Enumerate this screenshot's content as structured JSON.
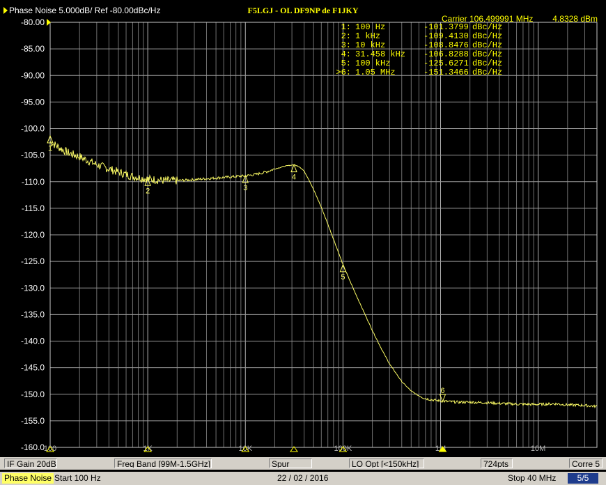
{
  "header": {
    "scale_label": "Phase Noise 5.000dB/ Ref -80.00dBc/Hz",
    "title": "F5LGJ - OL DF9NP de F1JKY",
    "carrier_label": "Carrier 106.499991 MHz",
    "carrier_power": "4.8328 dBm"
  },
  "markers": [
    {
      "index": "1:",
      "freq": "100 Hz",
      "value": "-101.3799",
      "unit": "dBc/Hz"
    },
    {
      "index": "2:",
      "freq": "1 kHz",
      "value": "-109.4130",
      "unit": "dBc/Hz"
    },
    {
      "index": "3:",
      "freq": "10 kHz",
      "value": "-108.8476",
      "unit": "dBc/Hz"
    },
    {
      "index": "4:",
      "freq": "31.458 kHz",
      "value": "-106.8288",
      "unit": "dBc/Hz"
    },
    {
      "index": "5:",
      "freq": "100 kHz",
      "value": "-125.6271",
      "unit": "dBc/Hz"
    },
    {
      "index": ">6:",
      "freq": "1.05 MHz",
      "value": "-151.3466",
      "unit": "dBc/Hz"
    }
  ],
  "status_bar": {
    "if_gain": "IF Gain 20dB",
    "freq_band": "Freq Band [99M-1.5GHz]",
    "spur": "Spur",
    "lo_opt": "LO Opt [<150kHz]",
    "points": "724pts",
    "corr": "Corre 5"
  },
  "footer": {
    "mode": "Phase Noise",
    "start": "Start 100 Hz",
    "date": "22 / 02 / 2016",
    "stop": "Stop 40 MHz",
    "page": "5/5"
  },
  "chart_data": {
    "type": "line",
    "x_scale": "log",
    "xlim": [
      100,
      40000000
    ],
    "ylim": [
      -160,
      -80
    ],
    "yticks": [
      -80,
      -85,
      -90,
      -95,
      -100,
      -105,
      -110,
      -115,
      -120,
      -125,
      -130,
      -135,
      -140,
      -145,
      -150,
      -155,
      -160
    ],
    "ytick_labels": [
      "-80.00",
      "-85.00",
      "-90.00",
      "-95.00",
      "-100.0",
      "-105.0",
      "-110.0",
      "-115.0",
      "-120.0",
      "-125.0",
      "-130.0",
      "-135.0",
      "-140.0",
      "-145.0",
      "-150.0",
      "-155.0",
      "-160.0"
    ],
    "xtick_labels": [
      {
        "x": 100,
        "label": "100"
      },
      {
        "x": 1000,
        "label": "1K"
      },
      {
        "x": 10000,
        "label": "10K"
      },
      {
        "x": 100000,
        "label": "100K"
      },
      {
        "x": 1000000,
        "label": "1M"
      },
      {
        "x": 10000000,
        "label": "10M"
      }
    ],
    "grid": true,
    "trace_color": "#ffff66",
    "series": [
      {
        "x": [
          100,
          150,
          200,
          300,
          500,
          700,
          1000,
          1500,
          2000,
          3000,
          5000,
          7000,
          10000,
          13000,
          16000,
          20000,
          25000,
          31458,
          36000,
          40000,
          45000,
          50000,
          60000,
          70000,
          80000,
          100000,
          120000,
          150000,
          200000,
          250000,
          300000,
          400000,
          500000,
          600000,
          700000,
          850000,
          1050000,
          1500000,
          2000000,
          3000000,
          5000000,
          7000000,
          10000000,
          15000000,
          20000000,
          30000000,
          40000000
        ],
        "y": [
          -102.5,
          -104.5,
          -105.3,
          -106.8,
          -108.2,
          -109.0,
          -109.5,
          -109.8,
          -109.8,
          -109.6,
          -109.3,
          -109.1,
          -108.9,
          -108.6,
          -108.2,
          -107.6,
          -107.1,
          -106.8,
          -107.2,
          -108.0,
          -109.7,
          -111.5,
          -114.8,
          -118.0,
          -120.8,
          -125.6,
          -129.0,
          -133.0,
          -138.0,
          -141.6,
          -144.3,
          -147.6,
          -149.4,
          -150.3,
          -150.8,
          -151.1,
          -151.3,
          -151.5,
          -151.5,
          -151.6,
          -151.8,
          -151.9,
          -151.9,
          -151.8,
          -152.0,
          -152.1,
          -152.3
        ]
      }
    ],
    "marker_points": [
      {
        "label": "1",
        "x": 100,
        "y": -101.3799
      },
      {
        "label": "2",
        "x": 1000,
        "y": -109.413
      },
      {
        "label": "3",
        "x": 10000,
        "y": -108.8476
      },
      {
        "label": "4",
        "x": 31458,
        "y": -106.8288
      },
      {
        "label": "5",
        "x": 100000,
        "y": -125.6271
      },
      {
        "label": "6",
        "x": 1050000,
        "y": -151.3466
      }
    ]
  }
}
